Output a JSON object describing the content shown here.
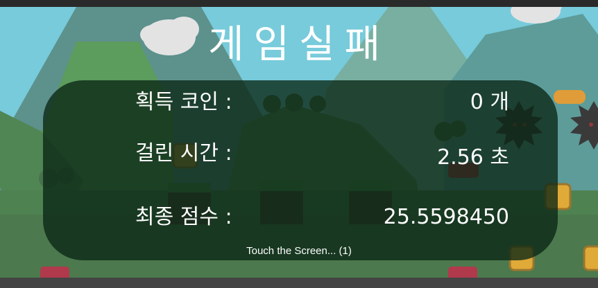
{
  "result": {
    "title": "게임실패",
    "rows": [
      {
        "label": "획득 코인 :",
        "value": "0 개"
      },
      {
        "label": "걸린 시간 :",
        "value": "2.56 초"
      },
      {
        "label": "최종 점수 :",
        "value": "25.5598450"
      }
    ],
    "prompt": "Touch the Screen... (1)"
  }
}
